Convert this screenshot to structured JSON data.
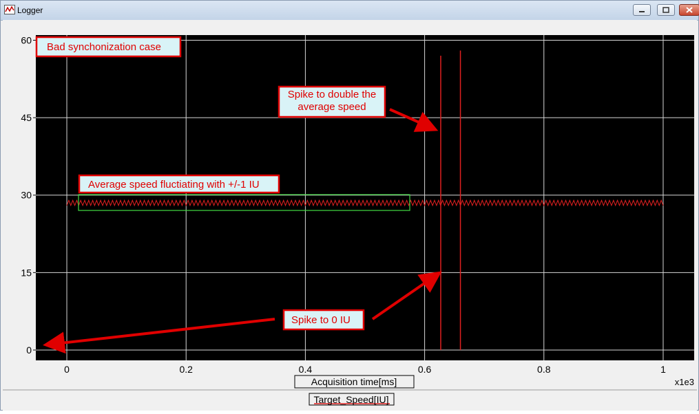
{
  "window": {
    "title": "Logger",
    "icon": "logger-chart-icon"
  },
  "chart_data": {
    "type": "line",
    "xlabel": "Acquisition time[ms]",
    "x_multiplier": "x1e3",
    "legend": [
      "Target_Speed[IU]"
    ],
    "xlim": [
      -0.052,
      1.052
    ],
    "ylim": [
      -2,
      61
    ],
    "x_ticks": [
      0,
      0.2,
      0.4,
      0.6,
      0.8,
      1
    ],
    "x_tick_labels": [
      "0",
      "0.2",
      "0.4",
      "0.6",
      "0.8",
      "1"
    ],
    "y_ticks": [
      0,
      15,
      30,
      45,
      60
    ],
    "y_tick_labels": [
      "0",
      "15",
      "30",
      "45",
      "60"
    ],
    "grid": true,
    "background": "#000000",
    "series": [
      {
        "name": "Target_Speed[IU]",
        "color": "#e02020",
        "baseline_range": [
          28,
          29
        ],
        "x_range": [
          0,
          1
        ],
        "spikes": [
          {
            "x": 0.627,
            "y_max": 57,
            "y_min": 0
          },
          {
            "x": 0.66,
            "y_max": 58,
            "y_min": 0
          }
        ]
      }
    ],
    "annotations": [
      {
        "text": "Bad synchonization case"
      },
      {
        "text": "Spike to double the average speed"
      },
      {
        "text": "Average speed fluctiating with +/-1 IU"
      },
      {
        "text": "Spike to 0 IU"
      }
    ]
  }
}
